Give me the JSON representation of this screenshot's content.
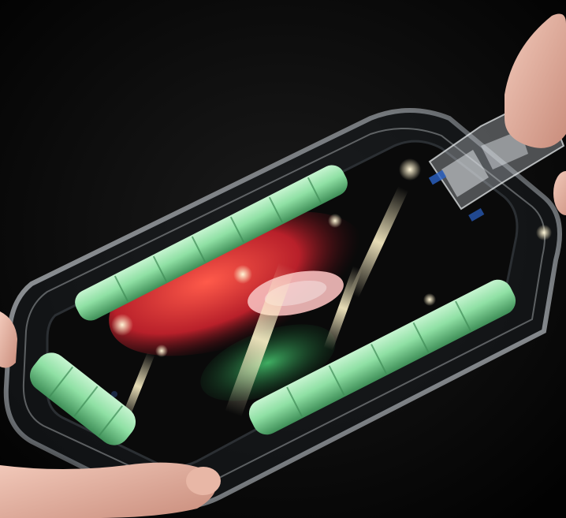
{
  "image": {
    "subject": "",
    "colors": {
      "background": "#050505",
      "tray_frame": "#c9ced3",
      "rollers": "#8fe0a4",
      "roller_shadow": "#4fa86a",
      "screen": "#0b0b0b",
      "wallpaper_red": "#c62a2a",
      "wallpaper_green": "#2f8f4f",
      "glare": "#fff2c8",
      "skin": "#e6b8a8"
    },
    "icons": []
  }
}
